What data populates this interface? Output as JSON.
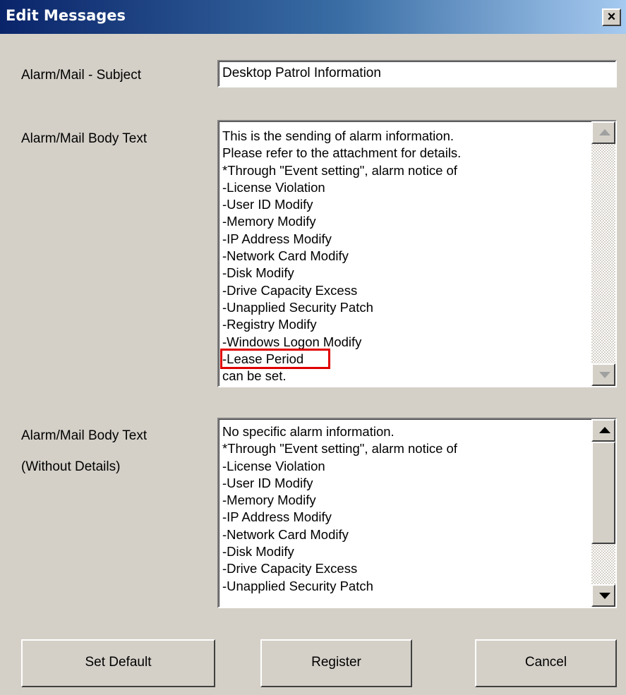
{
  "window": {
    "title": "Edit Messages",
    "close_glyph": "×"
  },
  "labels": {
    "subject": "Alarm/Mail - Subject",
    "body": "Alarm/Mail Body Text",
    "body_no_details_1": "Alarm/Mail Body Text",
    "body_no_details_2": "(Without Details)"
  },
  "subject_value": "Desktop Patrol Information",
  "body_lines": [
    "This is the sending of alarm information.",
    "Please refer to the attachment for details.",
    "*Through \"Event setting\", alarm notice of",
    " -License Violation",
    " -User ID Modify",
    " -Memory Modify",
    " -IP Address Modify",
    " -Network Card Modify",
    " -Disk Modify",
    " -Drive Capacity Excess",
    " -Unapplied Security Patch",
    " -Registry Modify",
    " -Windows Logon Modify",
    " -Lease Period",
    " can be set."
  ],
  "body_no_details_lines": [
    "No specific alarm information.",
    "*Through \"Event setting\", alarm notice of",
    " -License Violation",
    " -User ID Modify",
    " -Memory Modify",
    " -IP Address Modify",
    " -Network Card Modify",
    " -Disk Modify",
    " -Drive Capacity Excess",
    " -Unapplied Security Patch"
  ],
  "buttons": {
    "set_default": "Set Default",
    "register": "Register",
    "cancel": "Cancel"
  },
  "highlight": {
    "item": " -Lease Period",
    "color": "#e00000"
  },
  "colors": {
    "titlebar_start": "#0a246a",
    "titlebar_end": "#a6caf0",
    "face": "#d4d0c8"
  },
  "icons": {
    "close": "close-icon",
    "scroll_up": "arrow-up-icon",
    "scroll_down": "arrow-down-icon"
  }
}
